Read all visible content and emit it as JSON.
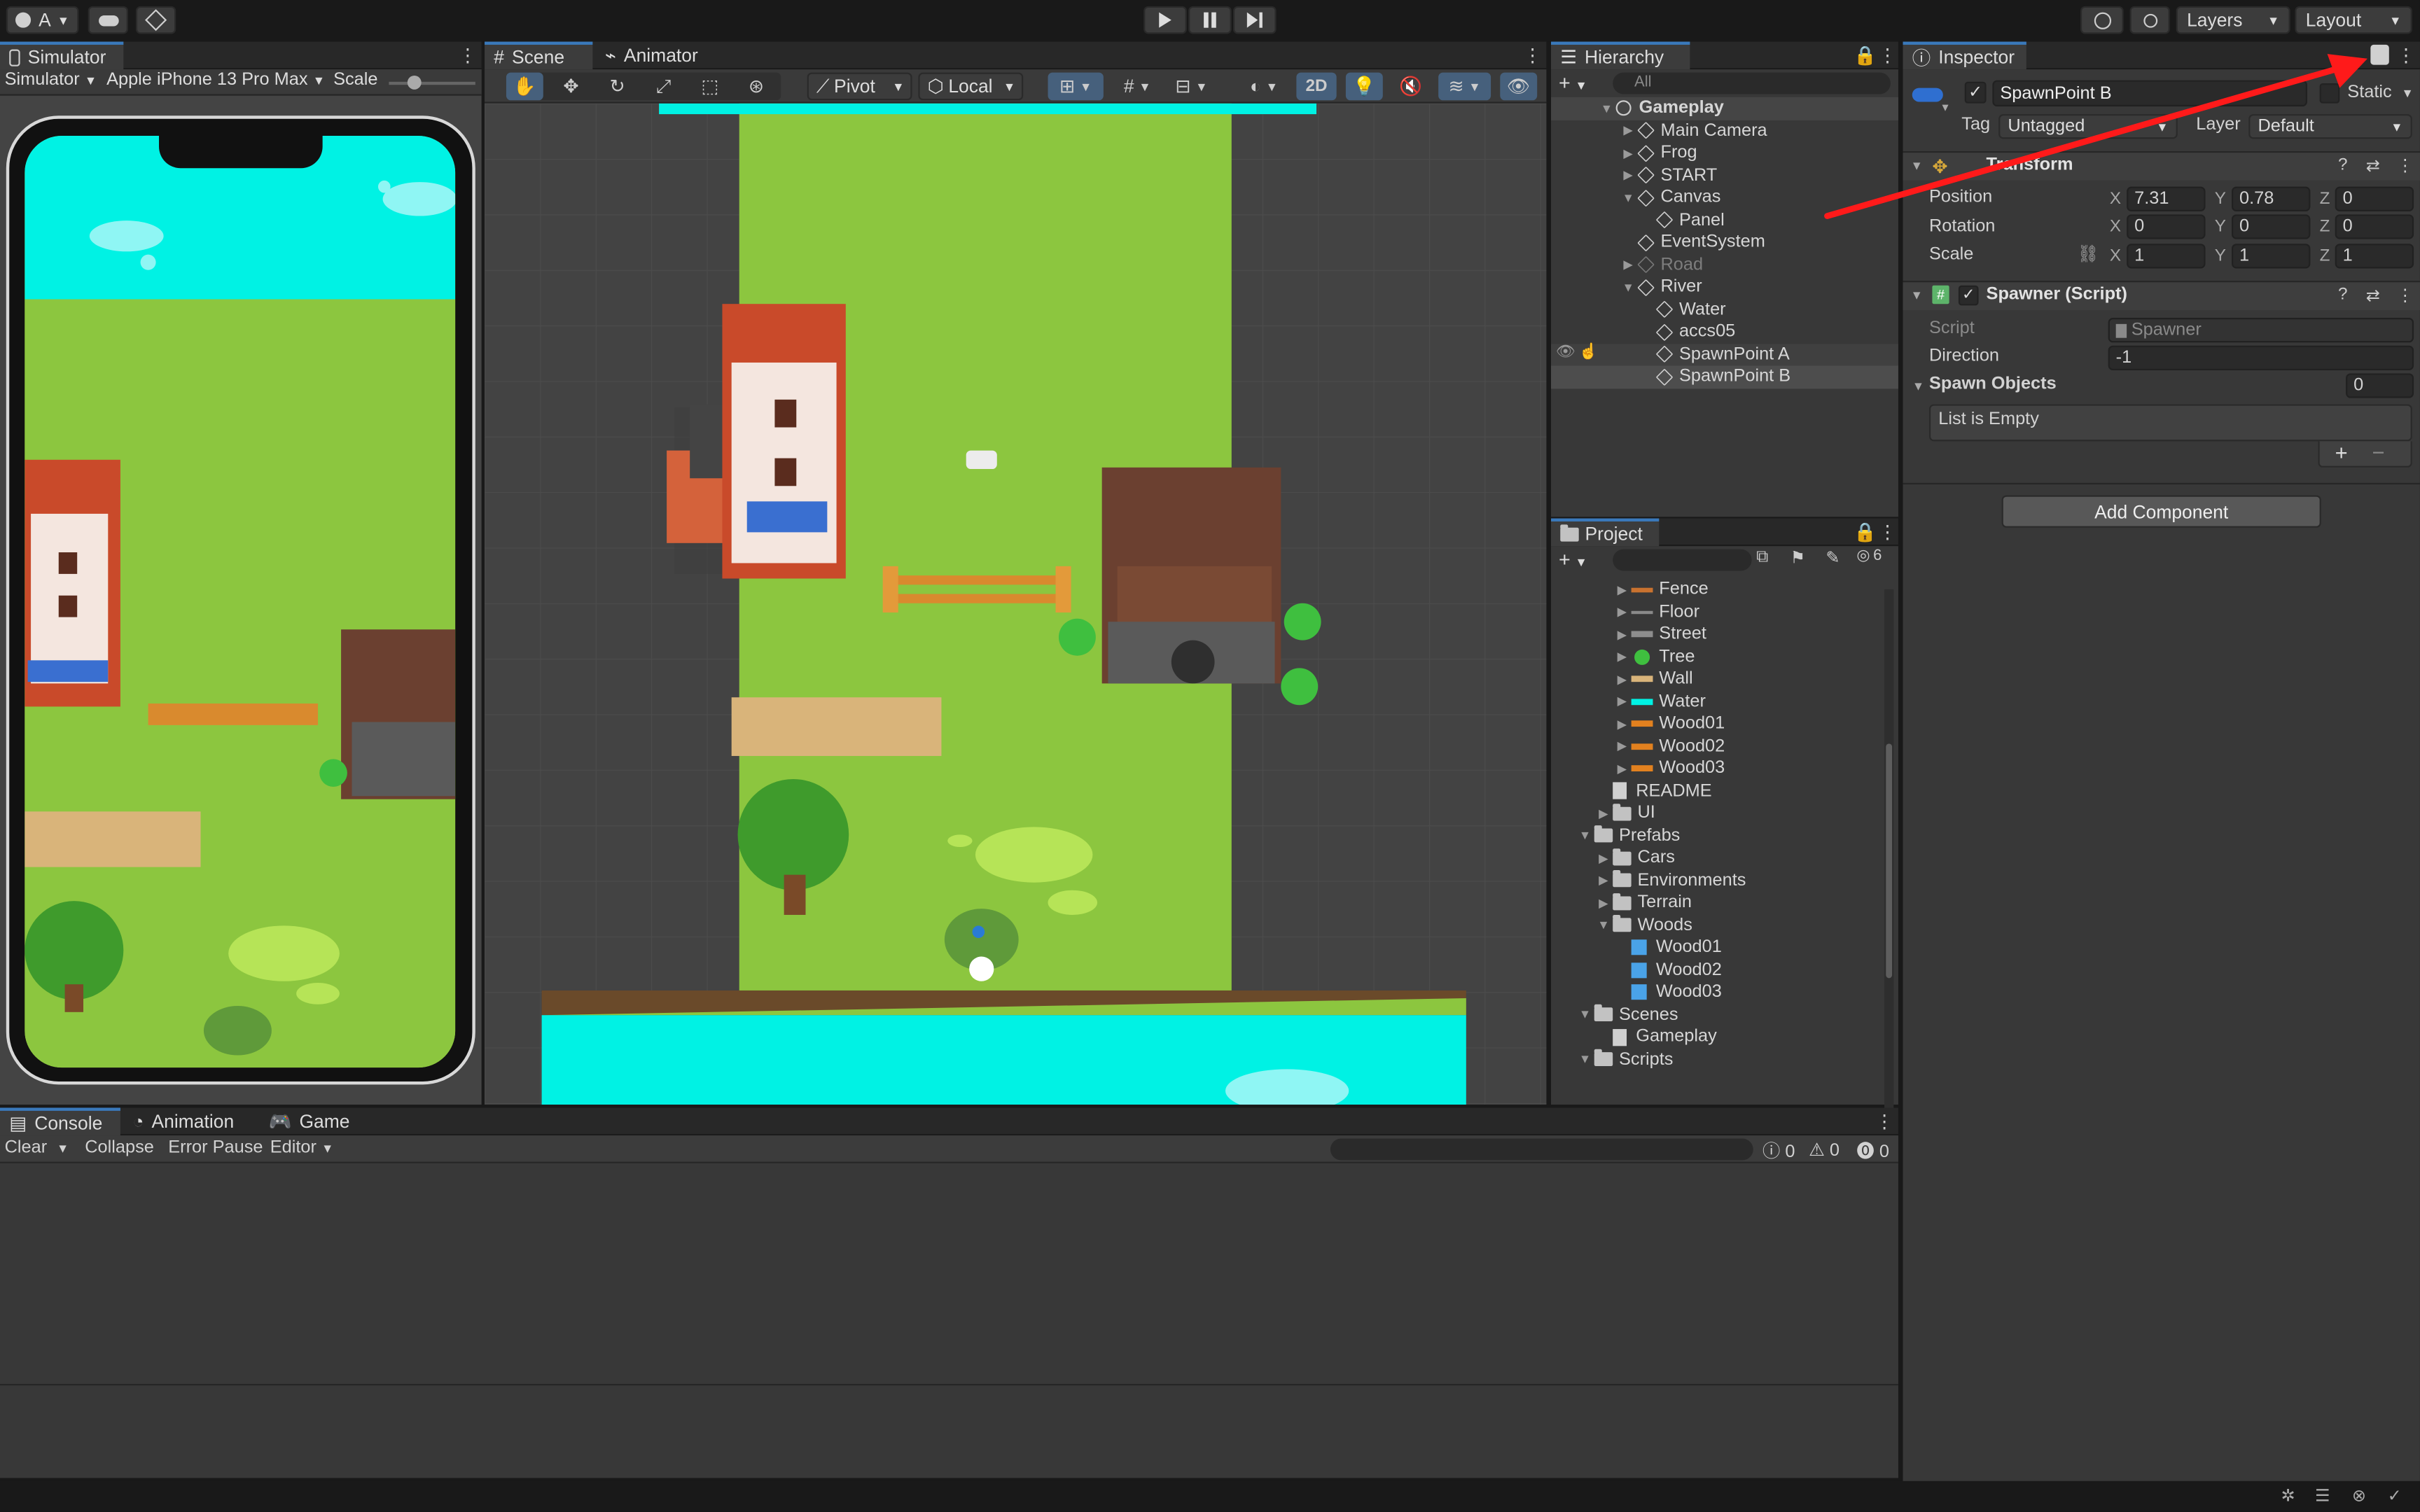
{
  "toolbar": {
    "account": "A",
    "layers": "Layers",
    "layout": "Layout"
  },
  "simulator": {
    "tab": "Simulator",
    "mode": "Simulator",
    "device": "Apple iPhone 13 Pro Max",
    "scale_label": "Scale"
  },
  "scene": {
    "tab_scene": "Scene",
    "tab_animator": "Animator",
    "pivot": "Pivot",
    "local": "Local",
    "btn_2d": "2D"
  },
  "hierarchy": {
    "tab": "Hierarchy",
    "search_placeholder": "All",
    "items": [
      {
        "label": "Gameplay"
      },
      {
        "label": "Main Camera"
      },
      {
        "label": "Frog"
      },
      {
        "label": "START"
      },
      {
        "label": "Canvas"
      },
      {
        "label": "Panel"
      },
      {
        "label": "EventSystem"
      },
      {
        "label": "Road"
      },
      {
        "label": "River"
      },
      {
        "label": "Water"
      },
      {
        "label": "accs05"
      },
      {
        "label": "SpawnPoint A"
      },
      {
        "label": "SpawnPoint B"
      }
    ]
  },
  "project": {
    "tab": "Project",
    "hidden_count": "6",
    "items": [
      {
        "label": "Fence"
      },
      {
        "label": "Floor"
      },
      {
        "label": "Street"
      },
      {
        "label": "Tree"
      },
      {
        "label": "Wall"
      },
      {
        "label": "Water"
      },
      {
        "label": "Wood01"
      },
      {
        "label": "Wood02"
      },
      {
        "label": "Wood03"
      },
      {
        "label": "README"
      },
      {
        "label": "UI"
      },
      {
        "label": "Prefabs"
      },
      {
        "label": "Cars"
      },
      {
        "label": "Environments"
      },
      {
        "label": "Terrain"
      },
      {
        "label": "Woods"
      },
      {
        "label": "Wood01"
      },
      {
        "label": "Wood02"
      },
      {
        "label": "Wood03"
      },
      {
        "label": "Scenes"
      },
      {
        "label": "Gameplay"
      },
      {
        "label": "Scripts"
      }
    ]
  },
  "inspector": {
    "tab": "Inspector",
    "object_name": "SpawnPoint B",
    "static_label": "Static",
    "tag_label": "Tag",
    "tag_value": "Untagged",
    "layer_label": "Layer",
    "layer_value": "Default",
    "transform": {
      "title": "Transform",
      "position": "Position",
      "rotation": "Rotation",
      "scale": "Scale",
      "pos_x": "7.31",
      "pos_y": "0.78",
      "pos_z": "0",
      "rot_x": "0",
      "rot_y": "0",
      "rot_z": "0",
      "scl_x": "1",
      "scl_y": "1",
      "scl_z": "1",
      "x": "X",
      "y": "Y",
      "z": "Z"
    },
    "spawner": {
      "title": "Spawner (Script)",
      "script_label": "Script",
      "script_value": "Spawner",
      "direction_label": "Direction",
      "direction_value": "-1",
      "spawn_objects_label": "Spawn Objects",
      "spawn_objects_count": "0",
      "list_empty": "List is Empty",
      "plus": "+",
      "minus": "−"
    },
    "add_component": "Add Component"
  },
  "console": {
    "tab_console": "Console",
    "tab_animation": "Animation",
    "tab_game": "Game",
    "clear": "Clear",
    "collapse": "Collapse",
    "error_pause": "Error Pause",
    "editor": "Editor",
    "log_count": "0",
    "warn_count": "0",
    "error_count": "0"
  },
  "colors": {
    "accent": "#3a79bb",
    "annotation_arrow": "#ff1a1a",
    "grass": "#8cc63f",
    "water": "#00ffe0"
  }
}
